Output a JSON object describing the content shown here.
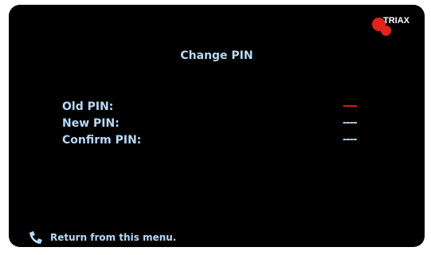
{
  "brand": {
    "name": "TRIAX",
    "accent": "#e2231a"
  },
  "title": "Change PIN",
  "fields": [
    {
      "label": "Old PIN:",
      "value": "----",
      "active": true
    },
    {
      "label": "New PIN:",
      "value": "----",
      "active": false
    },
    {
      "label": "Confirm PIN:",
      "value": "----",
      "active": false
    }
  ],
  "footer": {
    "icon": "back-icon",
    "text": "Return from this menu."
  },
  "colors": {
    "background": "#000000",
    "text": "#b6d9f6",
    "active_value": "#e2231a"
  }
}
